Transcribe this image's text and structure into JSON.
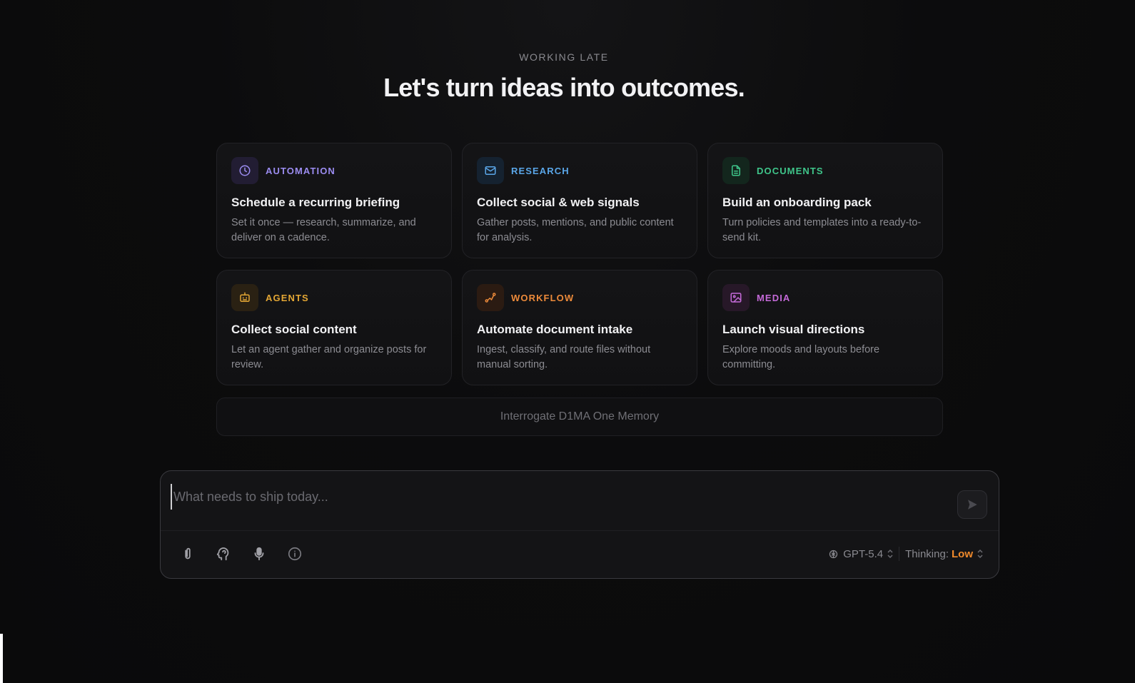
{
  "header": {
    "eyebrow": "WORKING LATE",
    "headline": "Let's turn ideas into outcomes."
  },
  "cards": [
    {
      "category": "AUTOMATION",
      "title": "Schedule a recurring briefing",
      "description": "Set it once — research, summarize, and deliver on a cadence.",
      "icon": "clock-icon",
      "accent": "#9b8cf0",
      "tile": "#221d33"
    },
    {
      "category": "RESEARCH",
      "title": "Collect social & web signals",
      "description": "Gather posts, mentions, and public content for analysis.",
      "icon": "mail-icon",
      "accent": "#5aa6e8",
      "tile": "#152230"
    },
    {
      "category": "DOCUMENTS",
      "title": "Build an onboarding pack",
      "description": "Turn policies and templates into a ready-to-send kit.",
      "icon": "document-icon",
      "accent": "#3fc58a",
      "tile": "#13261d"
    },
    {
      "category": "AGENTS",
      "title": "Collect social content",
      "description": "Let an agent gather and organize posts for review.",
      "icon": "robot-icon",
      "accent": "#e3a634",
      "tile": "#2a2113"
    },
    {
      "category": "WORKFLOW",
      "title": "Automate document intake",
      "description": "Ingest, classify, and route files without manual sorting.",
      "icon": "route-icon",
      "accent": "#ec8a3a",
      "tile": "#2b1b12"
    },
    {
      "category": "MEDIA",
      "title": "Launch visual directions",
      "description": "Explore moods and layouts before committing.",
      "icon": "image-icon",
      "accent": "#c46ad8",
      "tile": "#271828"
    }
  ],
  "memory_button": "Interrogate D1MA One Memory",
  "composer": {
    "placeholder": "What needs to ship today...",
    "tools": [
      "paperclip-icon",
      "brain-icon",
      "microphone-icon",
      "info-icon"
    ],
    "model": "GPT-5.4",
    "thinking_label": "Thinking:",
    "thinking_value": "Low"
  }
}
